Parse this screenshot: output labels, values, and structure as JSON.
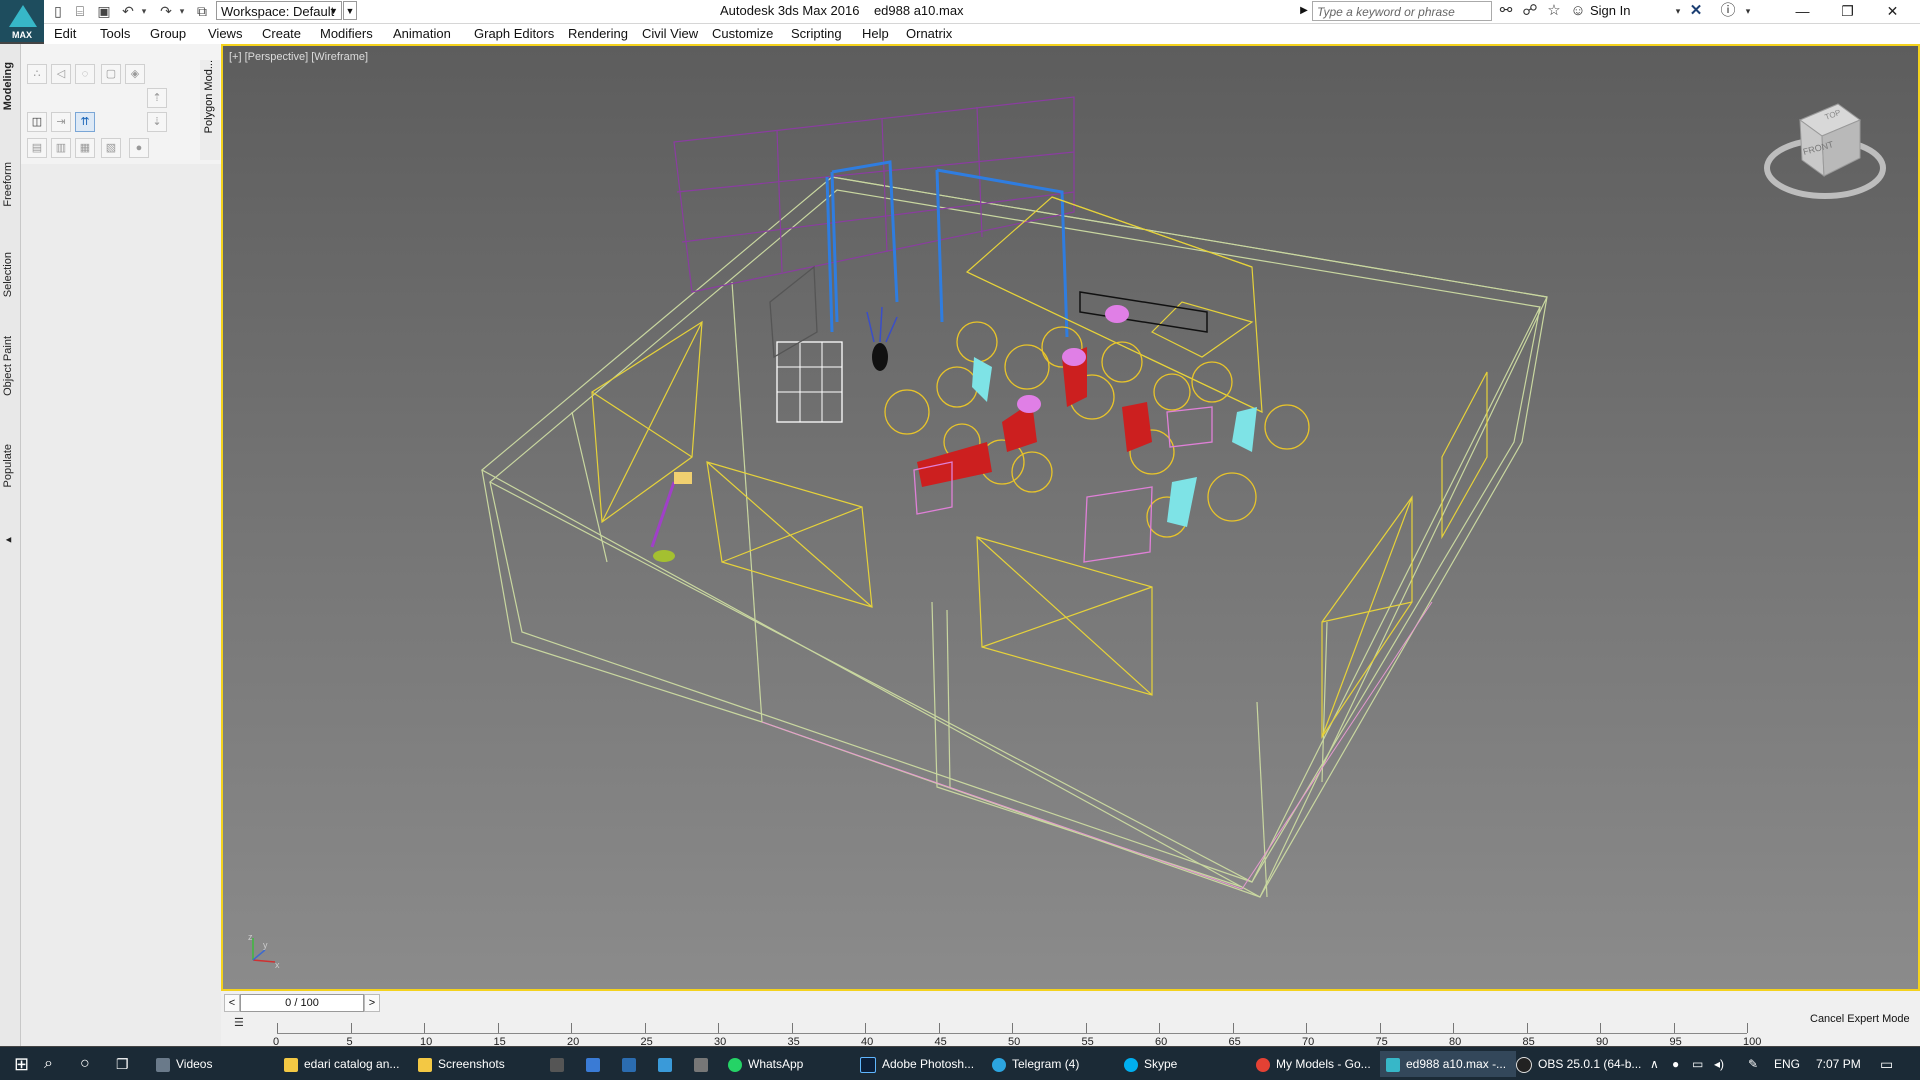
{
  "app": {
    "logo_tag": "MAX",
    "title": "Autodesk 3ds Max 2016",
    "filename": "ed988 a10.max",
    "workspace_label": "Workspace: Default",
    "search_placeholder": "Type a keyword or phrase",
    "sign_in": "Sign In"
  },
  "menu": [
    "Edit",
    "Tools",
    "Group",
    "Views",
    "Create",
    "Modifiers",
    "Animation",
    "Graph Editors",
    "Rendering",
    "Civil View",
    "Customize",
    "Scripting",
    "Help",
    "Ornatrix"
  ],
  "ribbon_tabs": [
    "Modeling",
    "Freeform",
    "Selection",
    "Object Paint",
    "Populate"
  ],
  "ribbon_panel_tab": "Polygon Mod...",
  "viewport": {
    "label": "[+] [Perspective] [Wireframe]",
    "viewcube_top": "TOP",
    "viewcube_front": "FRONT"
  },
  "timeline": {
    "frame_display": "0 / 100",
    "ticks": [
      "0",
      "5",
      "10",
      "15",
      "20",
      "25",
      "30",
      "35",
      "40",
      "45",
      "50",
      "55",
      "60",
      "65",
      "70",
      "75",
      "80",
      "85",
      "90",
      "95",
      "100"
    ],
    "cancel_expert": "Cancel Expert Mode"
  },
  "taskbar": {
    "items": [
      "Videos",
      "edari catalog an...",
      "Screenshots",
      "WhatsApp",
      "Adobe Photosh...",
      "Telegram (4)",
      "Skype",
      "My Models - Go...",
      "ed988 a10.max -...",
      "OBS 25.0.1 (64-b..."
    ],
    "language": "ENG",
    "time": "7:07 PM"
  },
  "colors": {
    "viewport_border": "#f4d21d",
    "wire_yellow": "#e6d23a",
    "wire_green": "#c9d7a0",
    "wire_purple": "#8a3da0",
    "taskbar": "#1b2a36"
  }
}
